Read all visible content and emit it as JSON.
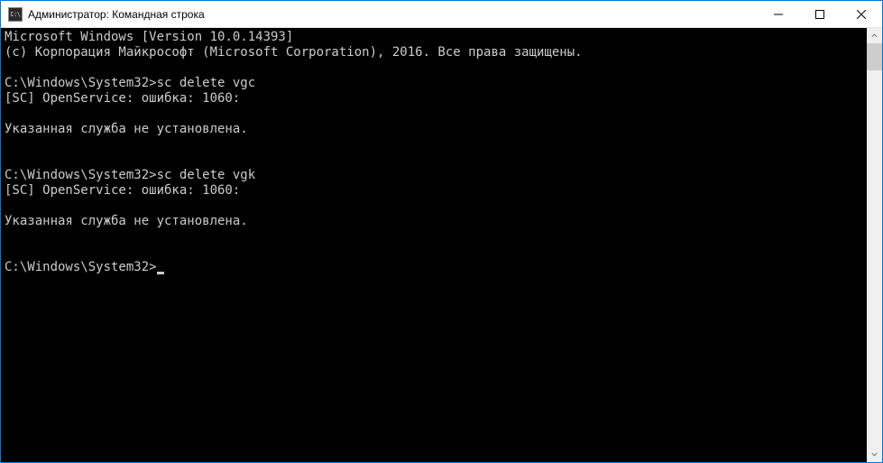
{
  "titlebar": {
    "icon_label": "C:\\",
    "title": "Администратор: Командная строка"
  },
  "terminal": {
    "lines": [
      "Microsoft Windows [Version 10.0.14393]",
      "(c) Корпорация Майкрософт (Microsoft Corporation), 2016. Все права защищены.",
      "",
      "C:\\Windows\\System32>sc delete vgc",
      "[SC] OpenService: ошибка: 1060:",
      "",
      "Указанная служба не установлена.",
      "",
      "",
      "C:\\Windows\\System32>sc delete vgk",
      "[SC] OpenService: ошибка: 1060:",
      "",
      "Указанная служба не установлена.",
      "",
      "",
      "C:\\Windows\\System32>"
    ]
  }
}
